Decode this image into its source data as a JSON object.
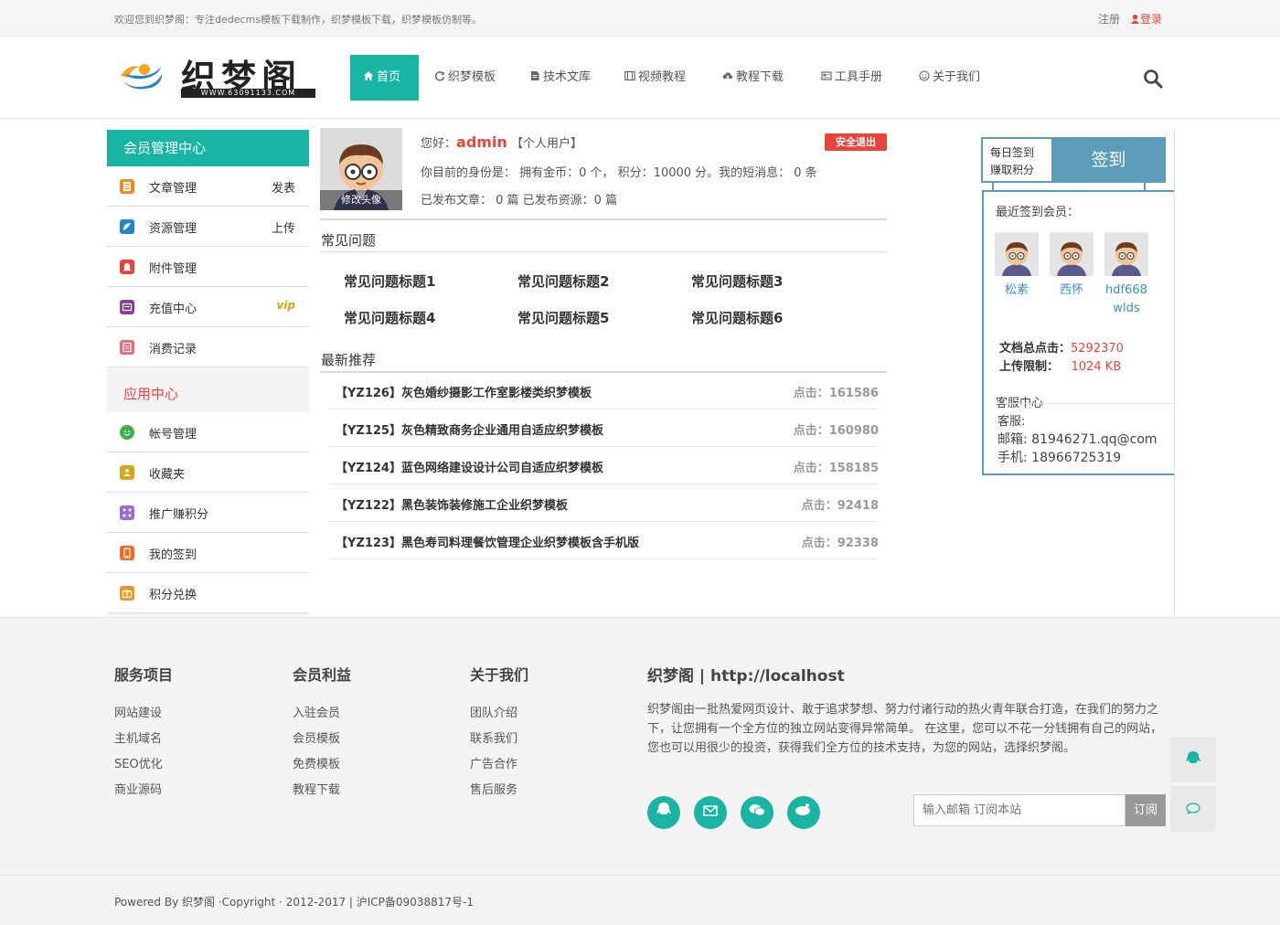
{
  "topbar": {
    "welcome": "欢迎您到织梦阁：专注dedecms模板下载制作，织梦模板下载，织梦模板仿制等。",
    "register": "注册",
    "login": "登录"
  },
  "logo": {
    "text": "织梦阁",
    "sub": "WWW.63091133.COM"
  },
  "nav": [
    {
      "label": "首页"
    },
    {
      "label": "织梦模板"
    },
    {
      "label": "技术文库"
    },
    {
      "label": "视频教程"
    },
    {
      "label": "教程下载"
    },
    {
      "label": "工具手册"
    },
    {
      "label": "关于我们"
    }
  ],
  "sidebar": {
    "title": "会员管理中心",
    "items": [
      {
        "label": "文章管理",
        "right": "发表"
      },
      {
        "label": "资源管理",
        "right": "上传"
      },
      {
        "label": "附件管理",
        "right": ""
      },
      {
        "label": "充值中心",
        "right": "vip"
      },
      {
        "label": "消费记录",
        "right": ""
      }
    ],
    "section": "应用中心",
    "apps": [
      {
        "label": "帐号管理"
      },
      {
        "label": "收藏夹"
      },
      {
        "label": "推广赚积分"
      },
      {
        "label": "我的签到"
      },
      {
        "label": "积分兑换"
      }
    ]
  },
  "profile": {
    "avatar_edit": "修改头像",
    "greeting": "您好：",
    "username": "admin",
    "usertype": "【个人用户】",
    "logout": "安全退出",
    "identity": "你目前的身份是：  拥有金币：0 个，  积分：10000 分。我的短消息：  0 条",
    "published": "已发布文章：  0 篇      已发布资源：0 篇"
  },
  "faq": {
    "title": "常见问题",
    "items": [
      "常见问题标题1",
      "常见问题标题2",
      "常见问题标题3",
      "常见问题标题4",
      "常见问题标题5",
      "常见问题标题6"
    ]
  },
  "recommend": {
    "title": "最新推荐",
    "items": [
      {
        "title": "【YZ126】灰色婚纱摄影工作室影楼类织梦模板",
        "hits": "点击：161586"
      },
      {
        "title": "【YZ125】灰色精致商务企业通用自适应织梦模板",
        "hits": "点击：160980"
      },
      {
        "title": "【YZ124】蓝色网络建设设计公司自适应织梦模板",
        "hits": "点击：158185"
      },
      {
        "title": "【YZ122】黑色装饰装修施工企业织梦模板",
        "hits": "点击：92418"
      },
      {
        "title": "【YZ123】黑色寿司料理餐饮管理企业织梦模板含手机版",
        "hits": "点击：92338"
      }
    ]
  },
  "signin": {
    "daily": "每日签到",
    "earn": "赚取积分",
    "button": "签到",
    "recent_title": "最近签到会员：",
    "members": [
      {
        "name": "松素"
      },
      {
        "name": "西怀"
      },
      {
        "name": "hdf668 wlds"
      }
    ],
    "total_label": "文档总点击：",
    "total_value": "5292370",
    "limit_label": "上传限制：",
    "limit_value": "1024 KB",
    "service_title": "客服中心",
    "service_line": "客服:",
    "email": "邮箱:  81946271.qq@com",
    "phone": "手机:  18966725319"
  },
  "footer": {
    "col1": {
      "title": "服务项目",
      "links": [
        "网站建设",
        "主机域名",
        "SEO优化",
        "商业源码"
      ]
    },
    "col2": {
      "title": "会员利益",
      "links": [
        "入驻会员",
        "会员模板",
        "免费模板",
        "教程下载"
      ]
    },
    "col3": {
      "title": "关于我们",
      "links": [
        "团队介绍",
        "联系我们",
        "广告合作",
        "售后服务"
      ]
    },
    "about_title": "织梦阁 | http://localhost",
    "about_desc": "织梦阁由一批热爱网页设计、敢于追求梦想、努力付诸行动的热火青年联合打造，在我们的努力之下，让您拥有一个全方位的独立网站变得异常简单。 在这里，您可以不花一分钱拥有自己的网站，您也可以用很少的投资，获得我们全方位的技术支持，为您的网站，选择织梦阁。",
    "subscribe_placeholder": "输入邮箱 订阅本站",
    "subscribe_button": "订阅",
    "copyright": "Powered By 织梦阁 ·Copyright · 2012-2017 | 沪ICP备09038817号-1"
  },
  "colors": {
    "accent": "#18b4a4",
    "red": "#e8443b",
    "blue": "#5b9cb9"
  }
}
